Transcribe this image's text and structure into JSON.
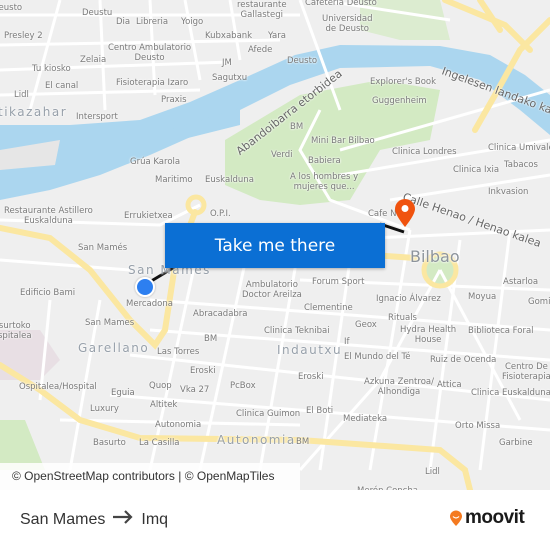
{
  "map": {
    "labels": [
      "Deusto",
      "Deustu",
      "Dia",
      "Libreria",
      "Yoigo",
      "restaurante\nGallastegi",
      "Cafeteria Deusto",
      "Universidad\nde Deusto",
      "Presley 2",
      "Kubxabank",
      "Yara",
      "Centro Ambulatorio\nDeusto",
      "Afede",
      "Zelaia",
      "Tu kiosko",
      "JM",
      "Deusto",
      "Sagutxu",
      "Fisioterapia Izaro",
      "El canal",
      "Lidl",
      "Praxis",
      "Intersport",
      "Explorer's Book",
      "Guggenheim",
      "BM",
      "Mini Bar Bilbao",
      "Clinica Londres",
      "Clinica Umivale",
      "Verdi",
      "Babiera",
      "Tabacos",
      "Clinica Ixia",
      "A los hombres y\nmujeres que...",
      "Grúa Karola",
      "Maritimo",
      "Euskalduna",
      "Inkvasion",
      "Restaurante Astillero\nEuskalduna",
      "Errukietxea",
      "O.P.I.",
      "Cafe N",
      "San Mamés",
      "Edificio Bami",
      "Mercadona",
      "Ambulatorio\nDoctor Areilza",
      "Forum Sport",
      "Astarloa",
      "Ignacio Álvarez",
      "Moyua",
      "Gomi",
      "Abracadabra",
      "Clementine",
      "Rituals",
      "San Mames",
      "Geox",
      "Hydra Health\nHouse",
      "Biblioteca Foral",
      "Clinica Teknibai",
      "BM",
      "surtoko\nspitalea",
      "If",
      "Las Torres",
      "El Mundo del Té",
      "Ruiz de Ocenda",
      "Centro De\nFisioterapia",
      "Eroski",
      "Eroski",
      "Azkuna Zentroa/\nAlhondiga",
      "Attica",
      "Ospitalea/Hospital",
      "Quop",
      "Vka 27",
      "PcBox",
      "Eguia",
      "Clinica Euskalduna",
      "Altitek",
      "Luxury",
      "Clinica Guimon",
      "El Boti",
      "Mediateka",
      "Orto Missa",
      "Autonomia",
      "BM",
      "Garbine",
      "Basurto",
      "La Casilla",
      "Lidl",
      "Merón Concha"
    ],
    "districts": [
      "tikazahar",
      "San Mamés",
      "Garellano",
      "Indautxu",
      "Autonomia"
    ],
    "city": "Bilbao",
    "roads": [
      "Abandoibarra etorbidea",
      "Ingelesen landako kalea",
      "Calle Henao / Henao kalea"
    ],
    "colors": {
      "water": "#abd6ef",
      "park": "#d3eac3",
      "major_road": "#fbe7a1",
      "origin": "#2d7ff0",
      "destination": "#f0530f",
      "button": "#0b6fd4"
    }
  },
  "cta": {
    "label": "Take me there"
  },
  "attribution": "© OpenStreetMap contributors | © OpenMapTiles",
  "footer": {
    "origin": "San Mames",
    "destination": "Imq",
    "arrow_icon": "arrow-right",
    "brand": "moovit"
  }
}
